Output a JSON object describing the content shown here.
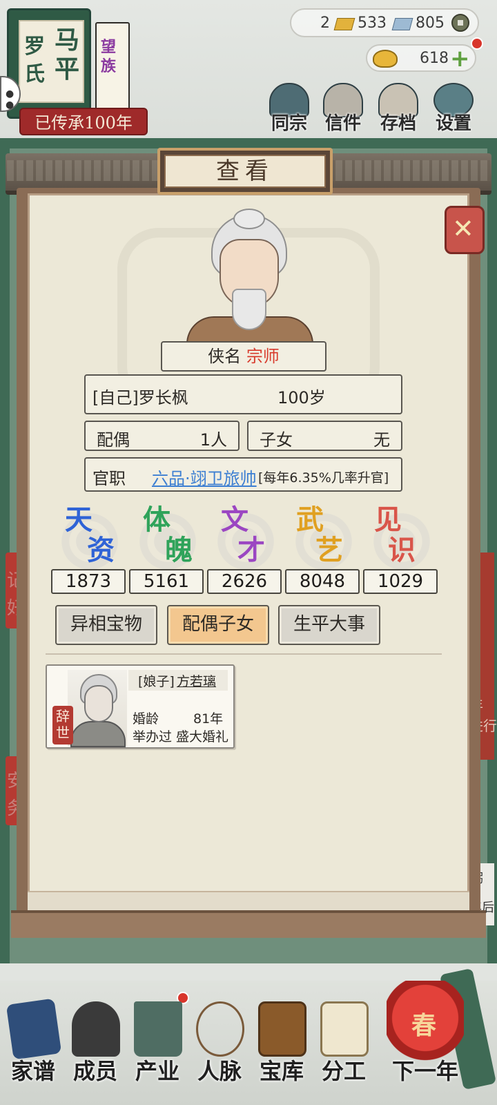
{
  "family": {
    "name_chars": [
      "马",
      "罗",
      "平",
      "氏"
    ],
    "side_book": "望族",
    "inherit_banner": "已传承100年"
  },
  "currency": {
    "gold_bars": "2",
    "silver_bars": "533",
    "coins": "805",
    "ingots": "618"
  },
  "top_menu": [
    {
      "label": "同宗",
      "icon": "clan-books-icon"
    },
    {
      "label": "信件",
      "icon": "letter-icon"
    },
    {
      "label": "存档",
      "icon": "save-scroll-icon"
    },
    {
      "label": "设置",
      "icon": "settings-gear-icon"
    }
  ],
  "dialog": {
    "title": "查看",
    "xia_label": "侠名",
    "xia_value": "宗师",
    "person_name": "[自己]罗长枫",
    "age": "100岁",
    "spouse_label": "配偶",
    "spouse_value": "1人",
    "children_label": "子女",
    "children_value": "无",
    "office_label": "官职",
    "office_value": "六品·翊卫旅帅",
    "office_note": "[每年6.35%几率升官]"
  },
  "stats": [
    {
      "chars": [
        "天",
        "资"
      ],
      "value": "1873",
      "color": "#2f63d6"
    },
    {
      "chars": [
        "体",
        "魄"
      ],
      "value": "5161",
      "color": "#2fa35a"
    },
    {
      "chars": [
        "文",
        "才"
      ],
      "value": "2626",
      "color": "#9b46c2"
    },
    {
      "chars": [
        "武",
        "艺"
      ],
      "value": "8048",
      "color": "#e0a021"
    },
    {
      "chars": [
        "见",
        "识"
      ],
      "value": "1029",
      "color": "#d9554a"
    }
  ],
  "tabs": [
    {
      "label": "异相宝物",
      "active": false
    },
    {
      "label": "配偶子女",
      "active": true
    },
    {
      "label": "生平大事",
      "active": false
    }
  ],
  "spouse_card": {
    "title_prefix": "[娘子]",
    "name": "方若璃",
    "status_stamp": "辞世",
    "marriage_label": "婚龄",
    "marriage_years": "81年",
    "wedding_prefix": "举办过",
    "wedding_type": "盛大婚礼"
  },
  "bottom_nav": [
    {
      "label": "家谱",
      "icon": "family-tree-book-icon"
    },
    {
      "label": "成员",
      "icon": "members-icon"
    },
    {
      "label": "产业",
      "icon": "property-building-icon"
    },
    {
      "label": "人脉",
      "icon": "network-icon"
    },
    {
      "label": "宝库",
      "icon": "treasure-chest-icon"
    },
    {
      "label": "分工",
      "icon": "work-scroll-icon"
    },
    {
      "label": "下一年",
      "icon": "next-year-lantern-icon"
    }
  ],
  "lantern_char": "春",
  "side_glimpse": {
    "left_chars": [
      "记",
      "好",
      "安",
      "务"
    ],
    "right_chars": [
      "年",
      "进行",
      "粥",
      "年后",
      "进行"
    ]
  }
}
